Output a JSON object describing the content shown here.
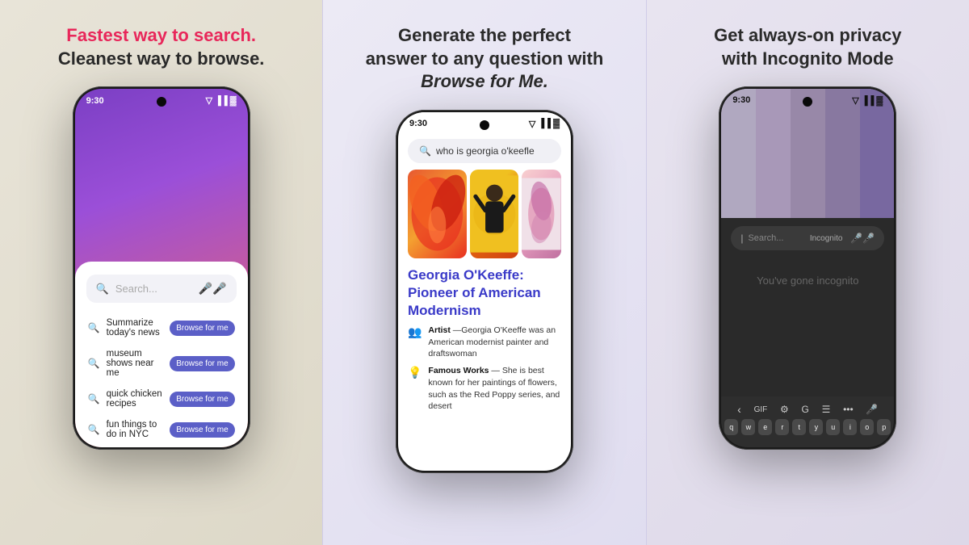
{
  "panel1": {
    "title_line1": "Fastest way to search.",
    "title_line2": "Cleanest way to browse.",
    "status_time": "9:30",
    "search_placeholder": "Search...",
    "suggestions": [
      {
        "text": "Summarize today's news",
        "btn": "Browse for me"
      },
      {
        "text": "museum shows near me",
        "btn": "Browse for me"
      },
      {
        "text": "quick chicken recipes",
        "btn": "Browse for me"
      },
      {
        "text": "fun things to do in NYC",
        "btn": "Browse for me"
      }
    ]
  },
  "panel2": {
    "title_line1": "Generate the perfect",
    "title_line2": "answer to any question with",
    "title_italic": "Browse for Me.",
    "status_time": "9:30",
    "search_query": "who is georgia o'keefle",
    "result_title": "Georgia O'Keeffe:\nPioneer of American\nModernism",
    "result_items": [
      {
        "icon": "👥",
        "label": "Artist",
        "text": "—Georgia O'Keeffe was an American modernist painter and draftswoman"
      },
      {
        "icon": "💡",
        "label": "Famous Works",
        "text": "— She is best known for her paintings of flowers, such as the Red Poppy series, and desert"
      }
    ]
  },
  "panel3": {
    "title_line1": "Get always-on privacy",
    "title_line2": "with Incognito Mode",
    "status_time": "9:30",
    "search_placeholder": "Search...",
    "incognito_label": "Incognito",
    "incognito_message": "You've gone incognito",
    "keyboard_row1": [
      "q",
      "w",
      "e",
      "r",
      "t",
      "y",
      "u",
      "i",
      "o",
      "p"
    ],
    "toolbar_items": [
      "‹",
      "GIF",
      "⚙",
      "G",
      "☰",
      "...",
      "🎤"
    ]
  },
  "icons": {
    "search": "🔍",
    "mic": "🎤",
    "wifi": "▲",
    "signal": "▐▐",
    "battery": "▓"
  }
}
